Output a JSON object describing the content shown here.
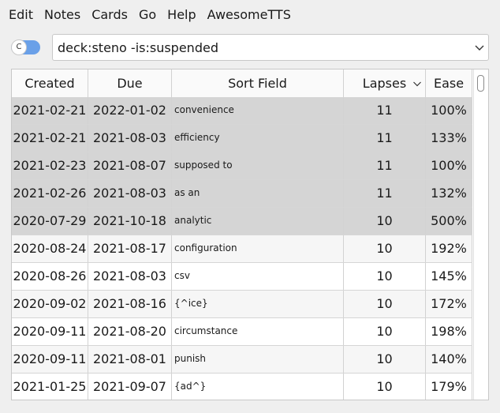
{
  "menu": {
    "items": [
      "Edit",
      "Notes",
      "Cards",
      "Go",
      "Help",
      "AwesomeTTS"
    ]
  },
  "toggle": {
    "label": "C",
    "accent_color": "#6aa0e8"
  },
  "search": {
    "value": "deck:steno -is:suspended"
  },
  "table": {
    "columns": [
      "Created",
      "Due",
      "Sort Field",
      "Lapses",
      "Ease"
    ],
    "rows": [
      {
        "created": "2021-02-21",
        "due": "2022-01-02",
        "sort_field": "convenience",
        "lapses": "11",
        "ease": "100%"
      },
      {
        "created": "2021-02-21",
        "due": "2021-08-03",
        "sort_field": "efficiency",
        "lapses": "11",
        "ease": "133%"
      },
      {
        "created": "2021-02-23",
        "due": "2021-08-07",
        "sort_field": "supposed to",
        "lapses": "11",
        "ease": "100%"
      },
      {
        "created": "2021-02-26",
        "due": "2021-08-03",
        "sort_field": "as an",
        "lapses": "11",
        "ease": "132%"
      },
      {
        "created": "2020-07-29",
        "due": "2021-10-18",
        "sort_field": "analytic",
        "lapses": "10",
        "ease": "500%"
      },
      {
        "created": "2020-08-24",
        "due": "2021-08-17",
        "sort_field": "configuration",
        "lapses": "10",
        "ease": "192%"
      },
      {
        "created": "2020-08-26",
        "due": "2021-08-03",
        "sort_field": "csv",
        "lapses": "10",
        "ease": "145%"
      },
      {
        "created": "2020-09-02",
        "due": "2021-08-16",
        "sort_field": "{^ice}",
        "lapses": "10",
        "ease": "172%"
      },
      {
        "created": "2020-09-11",
        "due": "2021-08-20",
        "sort_field": "circumstance",
        "lapses": "10",
        "ease": "198%"
      },
      {
        "created": "2020-09-11",
        "due": "2021-08-01",
        "sort_field": "punish",
        "lapses": "10",
        "ease": "140%"
      },
      {
        "created": "2021-01-25",
        "due": "2021-09-07",
        "sort_field": "{ad^}",
        "lapses": "10",
        "ease": "179%"
      }
    ]
  },
  "colors": {
    "suspended_row": "#d5d5d5",
    "alt_row": "#f6f6f6"
  }
}
